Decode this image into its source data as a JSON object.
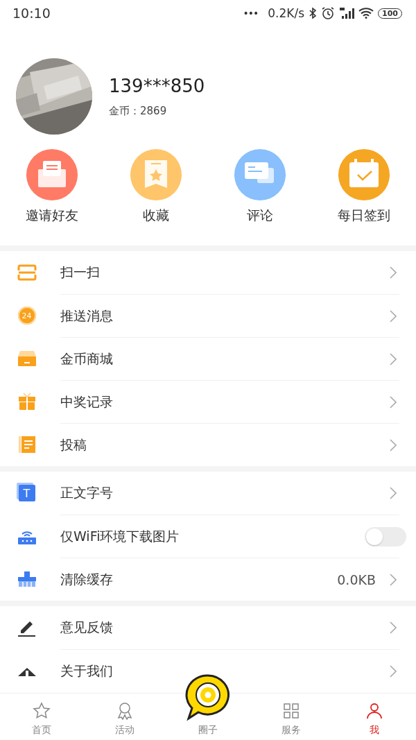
{
  "status_bar": {
    "time": "10:10",
    "dots": "•••",
    "speed": "0.2K/s",
    "battery": "100"
  },
  "profile": {
    "phone": "139***850",
    "coins_label": "金币：",
    "coins": "2869"
  },
  "quick_actions": [
    {
      "label": "邀请好友",
      "color": "#ff7b65"
    },
    {
      "label": "收藏",
      "color": "#ffc56a"
    },
    {
      "label": "评论",
      "color": "#88bffc"
    },
    {
      "label": "每日签到",
      "color": "#f5a623"
    }
  ],
  "sections": [
    {
      "rows": [
        {
          "kind": "chevron",
          "label": "扫一扫"
        },
        {
          "kind": "chevron",
          "label": "推送消息",
          "icon_text": "24"
        },
        {
          "kind": "chevron",
          "label": "金币商城"
        },
        {
          "kind": "chevron",
          "label": "中奖记录"
        },
        {
          "kind": "chevron",
          "label": "投稿"
        }
      ]
    },
    {
      "rows": [
        {
          "kind": "chevron",
          "label": "正文字号",
          "icon_text": "T"
        },
        {
          "kind": "toggle",
          "label": "仅WiFi环境下载图片",
          "on": false
        },
        {
          "kind": "value",
          "label": "清除缓存",
          "value": "0.0KB"
        }
      ]
    },
    {
      "rows": [
        {
          "kind": "chevron",
          "label": "意见反馈"
        },
        {
          "kind": "chevron",
          "label": "关于我们"
        }
      ]
    }
  ],
  "tab_bar": [
    {
      "label": "首页",
      "selected": false
    },
    {
      "label": "活动",
      "selected": false
    },
    {
      "label": "圈子",
      "selected": false,
      "kind": "center"
    },
    {
      "label": "服务",
      "selected": false
    },
    {
      "label": "我",
      "selected": true
    }
  ]
}
